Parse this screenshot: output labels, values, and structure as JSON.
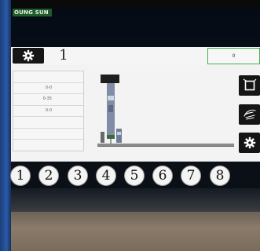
{
  "brand": {
    "label": "OUNG SUN"
  },
  "header": {
    "step_number": "1",
    "status_value": "0"
  },
  "params": {
    "values": [
      "",
      "0-0",
      "0-35",
      "0-0",
      "",
      ""
    ]
  },
  "numbers": [
    "1",
    "2",
    "3",
    "4",
    "5",
    "6",
    "7",
    "8"
  ],
  "colors": {
    "status_border": "#4caf4c",
    "brand_bg": "#1f5b2c",
    "bezel_blue": "#2a5aa8"
  },
  "icons": {
    "settings": "gear-icon",
    "home": "frame-icon",
    "manual": "hand-icon",
    "side_settings": "gear-icon"
  }
}
